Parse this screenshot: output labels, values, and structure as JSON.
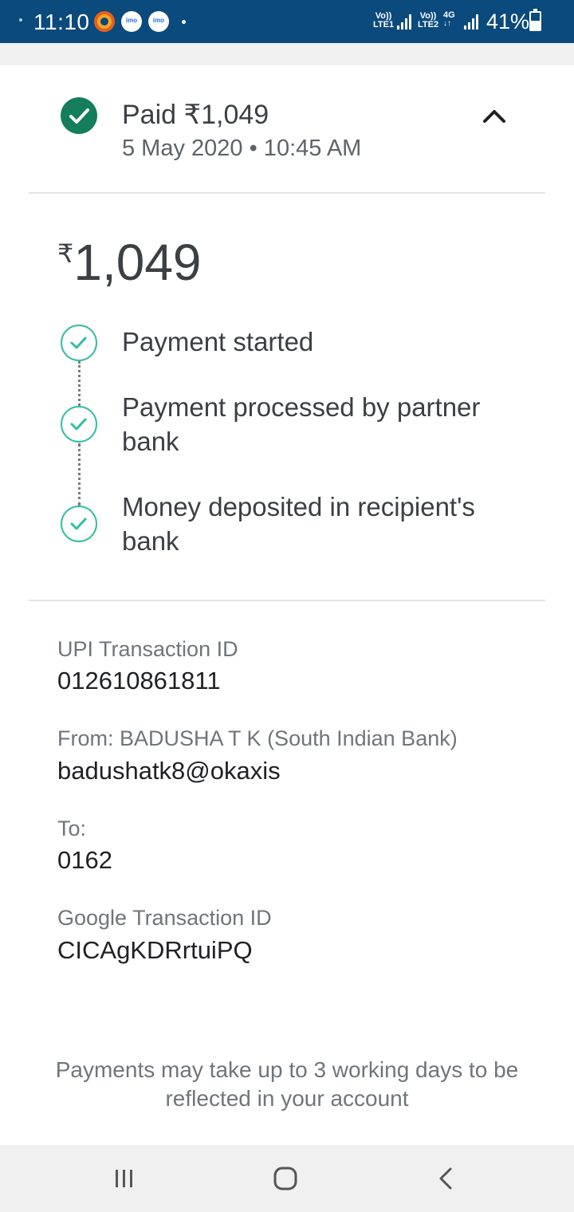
{
  "status_bar": {
    "time": "11:10",
    "sim1_label_top": "Vo))",
    "sim1_label_bottom": "LTE1",
    "sim2_label_top": "Vo))",
    "sim2_label_bottom": "LTE2",
    "network_type": "4G",
    "battery_percent": "41%",
    "notification_icons": [
      "radio-app-icon",
      "imo-icon",
      "imo-icon"
    ]
  },
  "header": {
    "title": "Paid ₹1,049",
    "date": "5 May 2020 • 10:45 AM",
    "status_color": "#137d5c"
  },
  "amount": {
    "currency": "₹",
    "value": "1,049"
  },
  "timeline": {
    "accent_color": "#33bda1",
    "steps": [
      {
        "label": "Payment started"
      },
      {
        "label": "Payment processed by partner bank"
      },
      {
        "label": "Money deposited in recipient's bank"
      }
    ]
  },
  "details": {
    "upi_label": "UPI Transaction ID",
    "upi_value": "012610861811",
    "from_label": "From: BADUSHA T K (South Indian Bank)",
    "from_value": "badushatk8@okaxis",
    "to_label": "To:",
    "to_value": "0162",
    "google_label": "Google Transaction ID",
    "google_value": "CICAgKDRrtuiPQ"
  },
  "footer_note": "Payments may take up to 3 working days to be reflected in your account",
  "nav_bar": {
    "buttons": [
      "recent-apps-icon",
      "home-icon",
      "back-icon"
    ]
  }
}
